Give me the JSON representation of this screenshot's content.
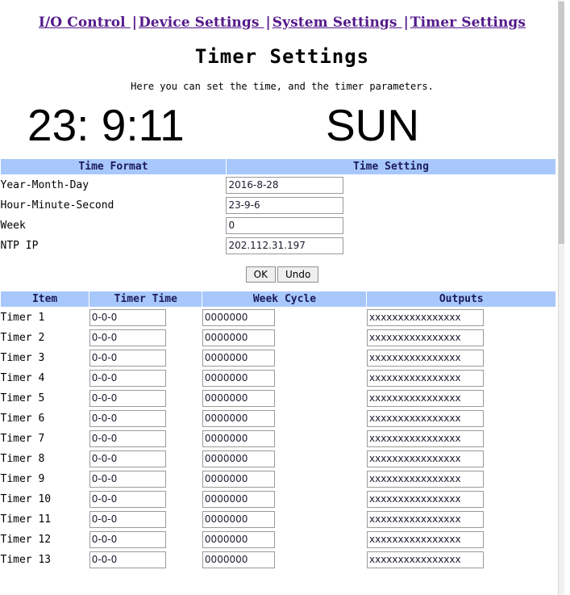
{
  "nav": {
    "separator": "|",
    "items": [
      {
        "label": "I/O Control "
      },
      {
        "label": "Device Settings "
      },
      {
        "label": "System Settings "
      },
      {
        "label": "Timer Settings"
      }
    ]
  },
  "header": {
    "title": "Timer Settings",
    "subtitle": "Here you can set the time, and the timer parameters."
  },
  "clock": {
    "time": "23: 9:11",
    "weekday": "SUN"
  },
  "time_table": {
    "columns": [
      "Time Format",
      "Time Setting"
    ],
    "rows": [
      {
        "label": "Year-Month-Day",
        "value": "2016-8-28"
      },
      {
        "label": "Hour-Minute-Second",
        "value": "23-9-6"
      },
      {
        "label": "Week",
        "value": "0"
      },
      {
        "label": "NTP IP",
        "value": "202.112.31.197"
      }
    ]
  },
  "buttons": {
    "ok": "OK",
    "undo": "Undo"
  },
  "timer_table": {
    "columns": [
      "Item",
      "Timer Time",
      "Week Cycle",
      "Outputs"
    ],
    "rows": [
      {
        "item": "Timer 1",
        "timer_time": "0-0-0",
        "week_cycle": "0000000",
        "outputs": "xxxxxxxxxxxxxxxx"
      },
      {
        "item": "Timer 2",
        "timer_time": "0-0-0",
        "week_cycle": "0000000",
        "outputs": "xxxxxxxxxxxxxxxx"
      },
      {
        "item": "Timer 3",
        "timer_time": "0-0-0",
        "week_cycle": "0000000",
        "outputs": "xxxxxxxxxxxxxxxx"
      },
      {
        "item": "Timer 4",
        "timer_time": "0-0-0",
        "week_cycle": "0000000",
        "outputs": "xxxxxxxxxxxxxxxx"
      },
      {
        "item": "Timer 5",
        "timer_time": "0-0-0",
        "week_cycle": "0000000",
        "outputs": "xxxxxxxxxxxxxxxx"
      },
      {
        "item": "Timer 6",
        "timer_time": "0-0-0",
        "week_cycle": "0000000",
        "outputs": "xxxxxxxxxxxxxxxx"
      },
      {
        "item": "Timer 7",
        "timer_time": "0-0-0",
        "week_cycle": "0000000",
        "outputs": "xxxxxxxxxxxxxxxx"
      },
      {
        "item": "Timer 8",
        "timer_time": "0-0-0",
        "week_cycle": "0000000",
        "outputs": "xxxxxxxxxxxxxxxx"
      },
      {
        "item": "Timer 9",
        "timer_time": "0-0-0",
        "week_cycle": "0000000",
        "outputs": "xxxxxxxxxxxxxxxx"
      },
      {
        "item": "Timer 10",
        "timer_time": "0-0-0",
        "week_cycle": "0000000",
        "outputs": "xxxxxxxxxxxxxxxx"
      },
      {
        "item": "Timer 11",
        "timer_time": "0-0-0",
        "week_cycle": "0000000",
        "outputs": "xxxxxxxxxxxxxxxx"
      },
      {
        "item": "Timer 12",
        "timer_time": "0-0-0",
        "week_cycle": "0000000",
        "outputs": "xxxxxxxxxxxxxxxx"
      },
      {
        "item": "Timer 13",
        "timer_time": "0-0-0",
        "week_cycle": "0000000",
        "outputs": "xxxxxxxxxxxxxxxx"
      }
    ]
  },
  "colors": {
    "header_bg": "#a8c8fb",
    "link": "#551a8b",
    "header_text": "#1b1b5a"
  }
}
